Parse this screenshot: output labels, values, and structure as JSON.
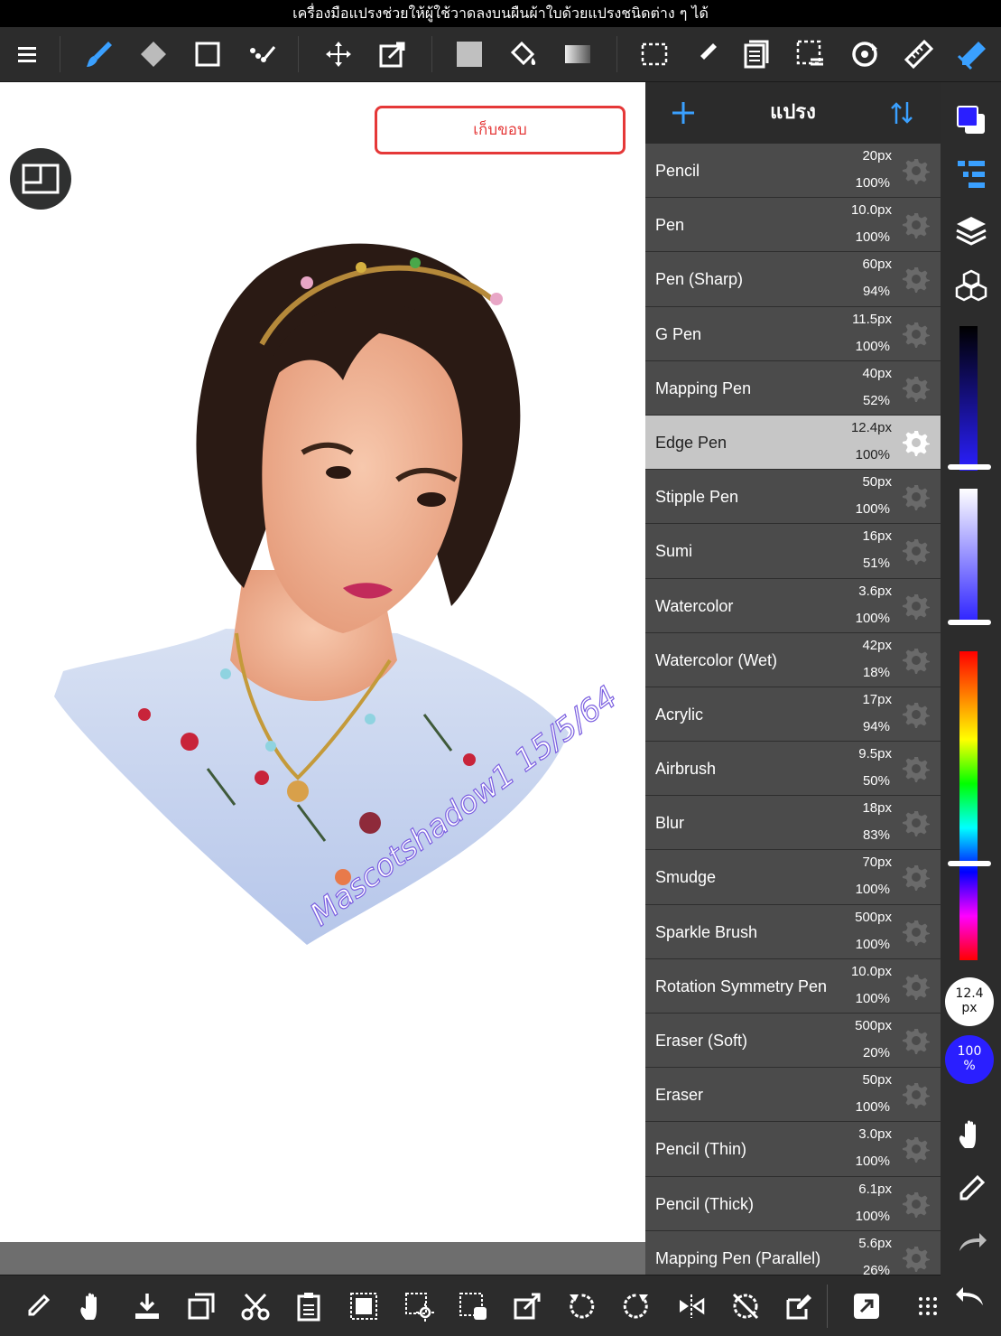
{
  "caption": "เครื่องมือแปรงช่วยให้ผู้ใช้วาดลงบนผืนผ้าใบด้วยแปรงชนิดต่าง ๆ ได้",
  "toolbar": {
    "icons": [
      "menu-icon",
      "brush-icon",
      "eraser-icon",
      "rectangle-icon",
      "dot-icon",
      "move-icon",
      "transform-icon",
      "fill-color-icon",
      "bucket-icon",
      "gradient-icon",
      "selection-icon",
      "select-pen-icon",
      "copy-icon",
      "select-layer-icon",
      "rotate-icon",
      "ruler-icon",
      "snap-icon"
    ]
  },
  "canvas": {
    "collapse_label": "เก็บขอบ",
    "signature_text": "Mascotshadow1 15/5/64"
  },
  "brush_panel": {
    "title": "แปรง",
    "brushes": [
      {
        "name": "Pencil",
        "size": "20px",
        "opacity": "100%"
      },
      {
        "name": "Pen",
        "size": "10.0px",
        "opacity": "100%"
      },
      {
        "name": "Pen (Sharp)",
        "size": "60px",
        "opacity": "94%"
      },
      {
        "name": "G Pen",
        "size": "11.5px",
        "opacity": "100%"
      },
      {
        "name": "Mapping Pen",
        "size": "40px",
        "opacity": "52%"
      },
      {
        "name": "Edge Pen",
        "size": "12.4px",
        "opacity": "100%",
        "selected": true
      },
      {
        "name": "Stipple Pen",
        "size": "50px",
        "opacity": "100%"
      },
      {
        "name": "Sumi",
        "size": "16px",
        "opacity": "51%"
      },
      {
        "name": "Watercolor",
        "size": "3.6px",
        "opacity": "100%"
      },
      {
        "name": "Watercolor (Wet)",
        "size": "42px",
        "opacity": "18%"
      },
      {
        "name": "Acrylic",
        "size": "17px",
        "opacity": "94%"
      },
      {
        "name": "Airbrush",
        "size": "9.5px",
        "opacity": "50%"
      },
      {
        "name": "Blur",
        "size": "18px",
        "opacity": "83%"
      },
      {
        "name": "Smudge",
        "size": "70px",
        "opacity": "100%"
      },
      {
        "name": "Sparkle Brush",
        "size": "500px",
        "opacity": "100%"
      },
      {
        "name": "Rotation Symmetry Pen",
        "size": "10.0px",
        "opacity": "100%"
      },
      {
        "name": "Eraser (Soft)",
        "size": "500px",
        "opacity": "20%"
      },
      {
        "name": "Eraser",
        "size": "50px",
        "opacity": "100%"
      },
      {
        "name": "Pencil (Thin)",
        "size": "3.0px",
        "opacity": "100%"
      },
      {
        "name": "Pencil (Thick)",
        "size": "6.1px",
        "opacity": "100%"
      },
      {
        "name": "Mapping Pen (Parallel)",
        "size": "5.6px",
        "opacity": "26%"
      }
    ]
  },
  "right_strip": {
    "color": "#2a1fff",
    "brush_size_value": "12.4",
    "brush_size_unit": "px",
    "opacity_value": "100",
    "opacity_unit": "%"
  },
  "bottom_bar": {
    "icons": [
      "eyedropper-icon",
      "hand-icon",
      "import-icon",
      "duplicate-icon",
      "cut-icon",
      "paste-icon",
      "select-all-icon",
      "magic-wand-icon",
      "select-layer-icon",
      "transform-icon",
      "rotate-left-icon",
      "rotate-right-icon",
      "flip-icon",
      "no-rotate-icon",
      "edit-icon",
      "share-icon",
      "grid-icon"
    ]
  }
}
